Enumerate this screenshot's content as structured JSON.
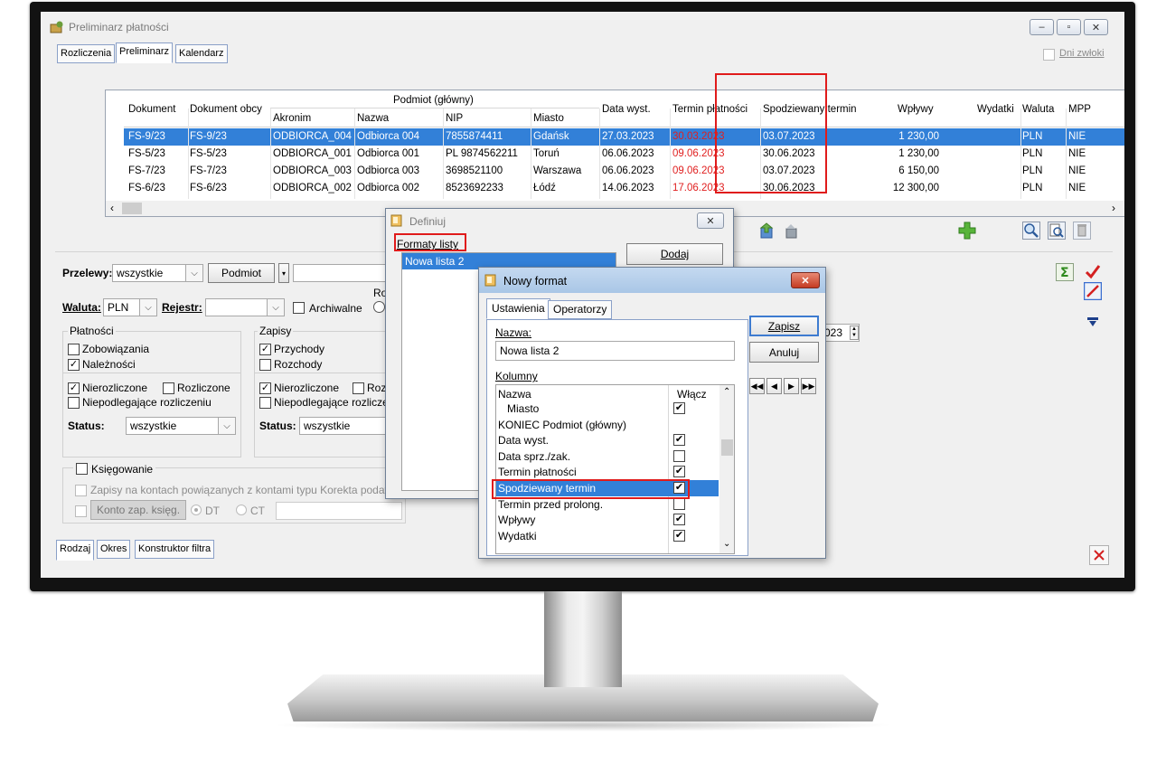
{
  "window": {
    "title": "Preliminarz płatności"
  },
  "top_tabs": [
    "Rozliczenia",
    "Preliminarz",
    "Kalendarz"
  ],
  "dni_zwloki": "Dni zwłoki",
  "grid": {
    "headers": {
      "dokument": "Dokument",
      "dokument_obcy": "Dokument obcy",
      "podmiot_group": "Podmiot (główny)",
      "akronim": "Akronim",
      "nazwa": "Nazwa",
      "nip": "NIP",
      "miasto": "Miasto",
      "data_wyst": "Data wyst.",
      "termin_platnosci": "Termin płatności",
      "spodziewany_termin": "Spodziewany termin",
      "wplywy": "Wpływy",
      "wydatki": "Wydatki",
      "waluta": "Waluta",
      "mpp": "MPP"
    },
    "rows": [
      {
        "dokument": "FS-9/23",
        "obcy": "FS-9/23",
        "akronim": "ODBIORCA_004",
        "nazwa": "Odbiorca 004",
        "nip": "7855874411",
        "miasto": "Gdańsk",
        "data": "27.03.2023",
        "termin": "30.03.2023",
        "spodziewany": "03.07.2023",
        "wplywy": "1 230,00",
        "waluta": "PLN",
        "mpp": "NIE"
      },
      {
        "dokument": "FS-5/23",
        "obcy": "FS-5/23",
        "akronim": "ODBIORCA_001",
        "nazwa": "Odbiorca 001",
        "nip": "PL 9874562211",
        "miasto": "Toruń",
        "data": "06.06.2023",
        "termin": "09.06.2023",
        "spodziewany": "30.06.2023",
        "wplywy": "1 230,00",
        "waluta": "PLN",
        "mpp": "NIE"
      },
      {
        "dokument": "FS-7/23",
        "obcy": "FS-7/23",
        "akronim": "ODBIORCA_003",
        "nazwa": "Odbiorca 003",
        "nip": "3698521100",
        "miasto": "Warszawa",
        "data": "06.06.2023",
        "termin": "09.06.2023",
        "spodziewany": "03.07.2023",
        "wplywy": "6 150,00",
        "waluta": "PLN",
        "mpp": "NIE"
      },
      {
        "dokument": "FS-6/23",
        "obcy": "FS-6/23",
        "akronim": "ODBIORCA_002",
        "nazwa": "Odbiorca 002",
        "nip": "8523692233",
        "miasto": "Łódź",
        "data": "14.06.2023",
        "termin": "17.06.2023",
        "spodziewany": "30.06.2023",
        "wplywy": "12 300,00",
        "waluta": "PLN",
        "mpp": "NIE"
      }
    ]
  },
  "filters": {
    "przelewy_label": "Przelewy:",
    "przelewy_value": "wszystkie",
    "podmiot_button": "Podmiot",
    "waluta_label": "Waluta:",
    "waluta_value": "PLN",
    "rejestr_label": "Rejestr:",
    "archiwalne": "Archiwalne",
    "ro_fragment": "Ro",
    "date_fragment": "023",
    "platnosci_title": "Płatności",
    "zobowiazania": "Zobowiązania",
    "naleznosci": "Należności",
    "nierozliczone": "Nierozliczone",
    "rozliczone": "Rozliczone",
    "niepodlegajace": "Niepodlegające rozliczeniu",
    "status_label": "Status:",
    "status_value": "wszystkie",
    "zapisy_title": "Zapisy",
    "przychody": "Przychody",
    "rozchody": "Rozchody",
    "z_nierozliczone": "Nierozliczone",
    "z_rozliczone": "Roz",
    "z_niepodlegajace": "Niepodlegające rozliczen",
    "z_status_value": "wszystkie",
    "ksiegowanie": "Księgowanie",
    "zapisy_kontach": "Zapisy na kontach powiązanych z kontami typu Korekta podatku",
    "konto_zap": "Konto zap. księg.",
    "dt": "DT",
    "ct": "CT"
  },
  "bottom_tabs": [
    "Rodzaj",
    "Okres",
    "Konstruktor filtra"
  ],
  "definiuj": {
    "title": "Definiuj",
    "formaty_label": "Formaty listy",
    "list_item": "Nowa lista 2",
    "dodaj": "Dodaj"
  },
  "nowy_format": {
    "title": "Nowy format",
    "tabs": [
      "Ustawienia",
      "Operatorzy"
    ],
    "nazwa_label": "Nazwa:",
    "nazwa_value": "Nowa lista 2",
    "kolumny_label": "Kolumny",
    "col_header_nazwa": "Nazwa",
    "col_header_wlacz": "Włącz",
    "columns": [
      {
        "name": "Miasto",
        "checked": "✔",
        "indent": true
      },
      {
        "name": "KONIEC Podmiot (główny)",
        "checked": "",
        "nobox": true
      },
      {
        "name": "Data wyst.",
        "checked": "✔"
      },
      {
        "name": "Data sprz./zak.",
        "checked": ""
      },
      {
        "name": "Termin płatności",
        "checked": "✔"
      },
      {
        "name": "Spodziewany termin",
        "checked": "✔",
        "selected": true
      },
      {
        "name": "Termin przed prolong.",
        "checked": ""
      },
      {
        "name": "Wpływy",
        "checked": "✔"
      },
      {
        "name": "Wydatki",
        "checked": "✔"
      }
    ],
    "zapisz": "Zapisz",
    "anuluj": "Anuluj"
  },
  "colors": {
    "selection": "#3280d8",
    "highlight_box": "#e01b1b",
    "overdue_text": "#e02020"
  }
}
